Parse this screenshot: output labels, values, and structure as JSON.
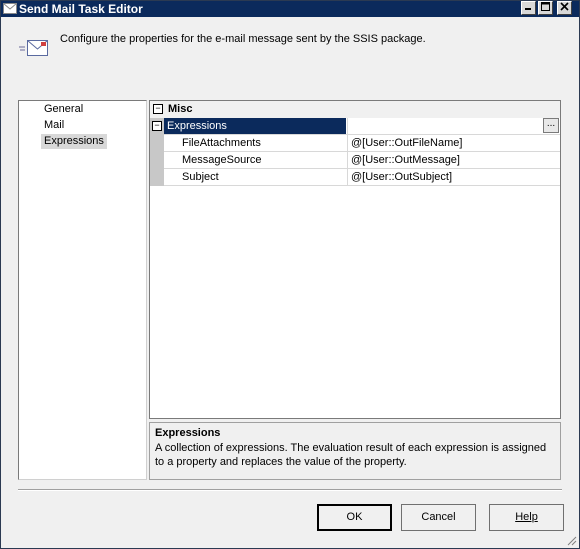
{
  "window": {
    "title": "Send Mail Task Editor"
  },
  "header": {
    "description": "Configure the properties for the e-mail message sent by the SSIS package."
  },
  "nav": {
    "items": [
      {
        "label": "General"
      },
      {
        "label": "Mail"
      },
      {
        "label": "Expressions"
      }
    ],
    "selected": "Expressions"
  },
  "grid": {
    "category": "Misc",
    "expressions_label": "Expressions",
    "ellipsis": "...",
    "properties": [
      {
        "name": "FileAttachments",
        "value": "@[User::OutFileName]"
      },
      {
        "name": "MessageSource",
        "value": "@[User::OutMessage]"
      },
      {
        "name": "Subject",
        "value": "@[User::OutSubject]"
      }
    ]
  },
  "description_panel": {
    "title": "Expressions",
    "text": "A collection of expressions. The evaluation result of each expression is assigned to a property and replaces the value of the property."
  },
  "buttons": {
    "ok": "OK",
    "cancel": "Cancel",
    "help": "Help"
  },
  "colors": {
    "titlebar": "#0b2a5c",
    "selection": "#0b2a5c",
    "dialog_bg": "#f0f0f0"
  }
}
